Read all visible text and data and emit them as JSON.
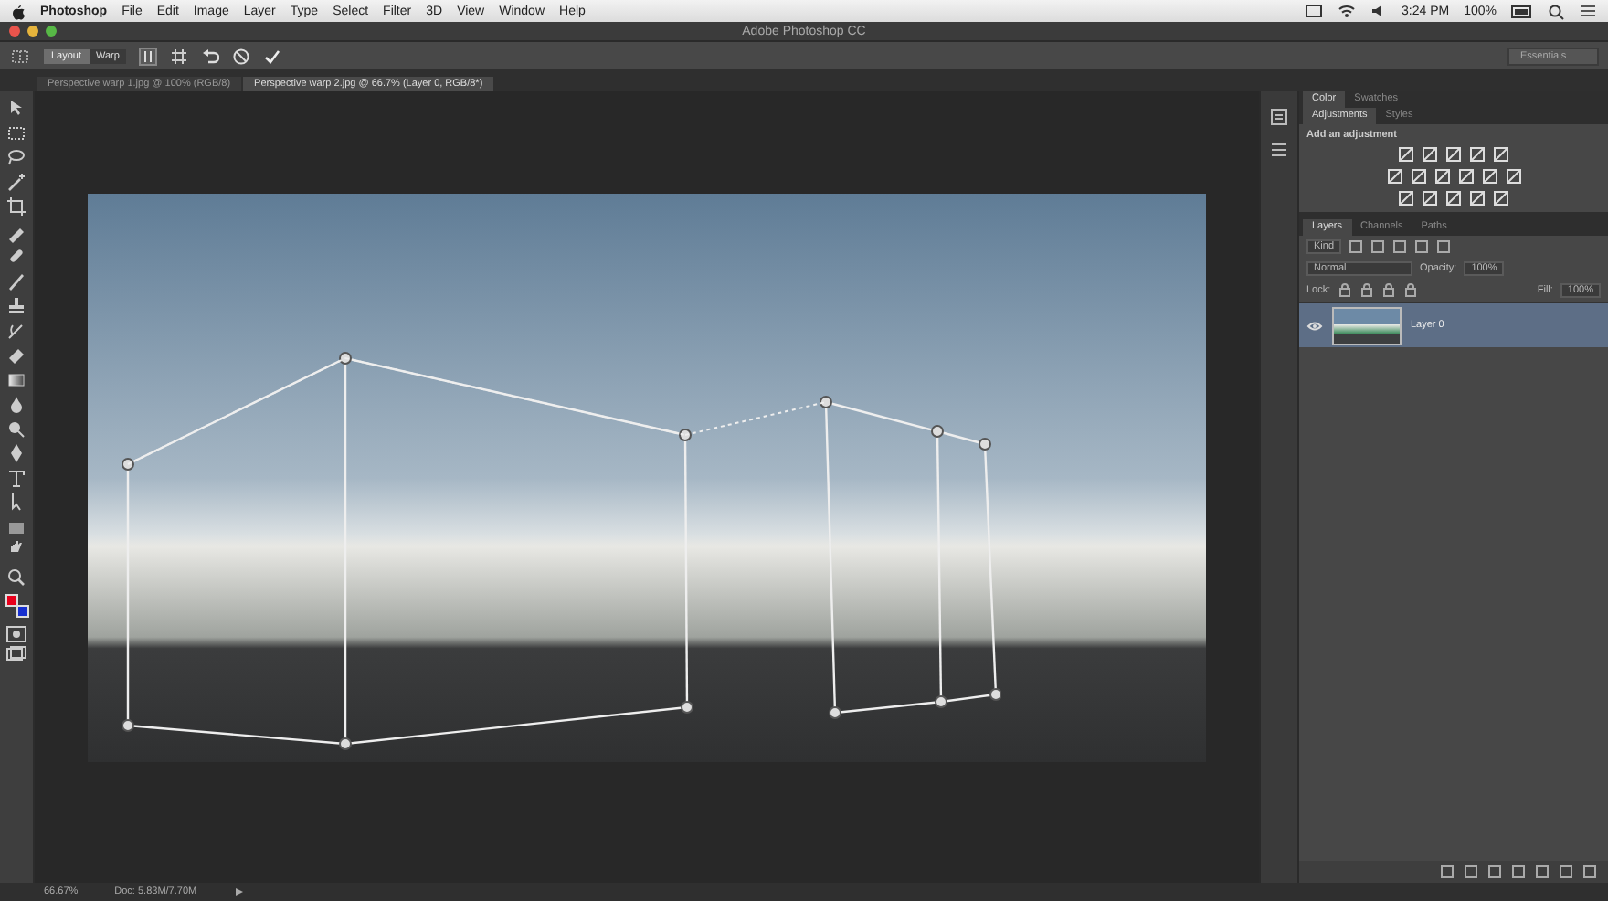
{
  "menu_bar": {
    "app_name": "Photoshop",
    "items": [
      "File",
      "Edit",
      "Image",
      "Layer",
      "Type",
      "Select",
      "Filter",
      "3D",
      "View",
      "Window",
      "Help"
    ],
    "clock": "3:24 PM",
    "battery": "100%"
  },
  "window": {
    "title": "Adobe Photoshop CC"
  },
  "options_bar": {
    "modes": [
      {
        "label": "Layout",
        "selected": true
      },
      {
        "label": "Warp",
        "selected": false
      }
    ],
    "workspace": "Essentials"
  },
  "document_tabs": [
    {
      "label": "Perspective warp 1.jpg @ 100% (RGB/8)",
      "selected": false
    },
    {
      "label": "Perspective warp 2.jpg @ 66.7% (Layer 0, RGB/8*)",
      "selected": true
    }
  ],
  "tools": {
    "color_swatches": [
      {
        "kind": "foreground",
        "color": "#e8001c"
      },
      {
        "kind": "background",
        "color": "#1730d0"
      }
    ]
  },
  "panels": {
    "color_tabs": [
      {
        "label": "Color",
        "selected": true
      },
      {
        "label": "Swatches",
        "selected": false
      }
    ],
    "adjustments_tabs": [
      {
        "label": "Adjustments",
        "selected": true
      },
      {
        "label": "Styles",
        "selected": false
      }
    ],
    "adjustments_hint": "Add an adjustment",
    "layers_tabs": [
      {
        "label": "Layers",
        "selected": true
      },
      {
        "label": "Channels",
        "selected": false
      },
      {
        "label": "Paths",
        "selected": false
      }
    ],
    "filter_kind": "Kind",
    "blend_mode": "Normal",
    "opacity_label": "Opacity:",
    "opacity": "100%",
    "lock_label": "Lock:",
    "fill_label": "Fill:",
    "fill": "100%",
    "layers": [
      {
        "name": "Layer 0",
        "selected": true,
        "visible": true
      }
    ]
  },
  "status_bar": {
    "zoom": "66.67%",
    "doc_size": "Doc: 5.83M/7.70M"
  }
}
